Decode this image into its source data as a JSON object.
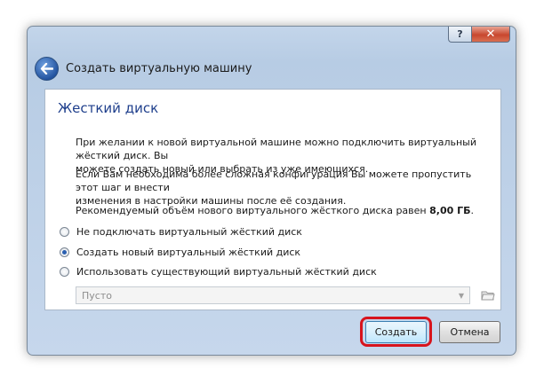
{
  "window": {
    "title": "Создать виртуальную машину",
    "help_label": "?",
    "close_label": "✕"
  },
  "page": {
    "heading": "Жесткий диск",
    "para1_line1": "При желании к новой виртуальной машине можно подключить виртуальный жёсткий диск. Вы",
    "para1_line2": "можете создать новый или выбрать из уже имеющихся.",
    "para2_line1": "Если Вам необходима более сложная конфигурация Вы можете пропустить этот шаг и внести",
    "para2_line2": "изменения в настройки машины после её создания.",
    "recommend_prefix": "Рекомендуемый объём нового виртуального жёсткого диска равен ",
    "recommend_size": "8,00 ГБ",
    "recommend_suffix": "."
  },
  "options": [
    {
      "label": "Не подключать виртуальный жёсткий диск",
      "checked": false
    },
    {
      "label": "Создать новый виртуальный жёсткий диск",
      "checked": true
    },
    {
      "label": "Использовать существующий виртуальный жёсткий диск",
      "checked": false
    }
  ],
  "disk_select": {
    "value": "Пусто"
  },
  "buttons": {
    "create": "Создать",
    "cancel": "Отмена"
  },
  "icons": {
    "back": "back-arrow-icon",
    "folder": "folder-open-icon",
    "combo": "chevron-down-icon"
  }
}
